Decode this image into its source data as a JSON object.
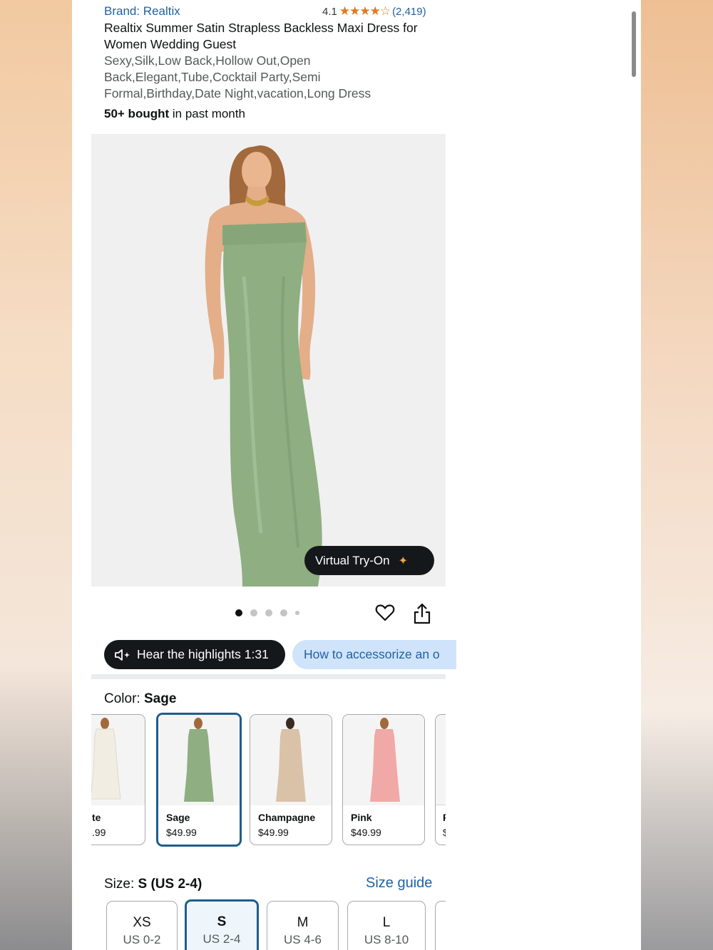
{
  "product": {
    "brand": "Brand: Realtix",
    "rating_value": "4.1",
    "rating_stars": "★★★★☆",
    "rating_count": "(2,419)",
    "title": "Realtix Summer Satin Strapless Backless Maxi Dress for Women Wedding Guest",
    "subtitle": "Sexy,Silk,Low Back,Hollow Out,Open Back,Elegant,Tube,Cocktail Party,Semi Formal,Birthday,Date Night,vacation,Long Dress",
    "bought_bold": "50+ bought",
    "bought_rest": " in past month"
  },
  "gallery": {
    "virtual_try_on": "Virtual Try-On",
    "image_count": 5,
    "active_index": 0
  },
  "actions": {
    "highlights": "Hear the highlights 1:31",
    "accessorize": "How to accessorize an o"
  },
  "color": {
    "label": "Color: ",
    "selected": "Sage",
    "options": [
      {
        "name": "te",
        "price": ".99",
        "color": "#f2ede2"
      },
      {
        "name": "Sage",
        "price": "$49.99",
        "color": "#8fae82"
      },
      {
        "name": "Champagne",
        "price": "$49.99",
        "color": "#d9c2a8"
      },
      {
        "name": "Pink",
        "price": "$49.99",
        "color": "#f0a9a7"
      },
      {
        "name": "F",
        "price": "$",
        "color": "#dddddd"
      }
    ]
  },
  "size": {
    "label": "Size: ",
    "selected": "S (US 2-4)",
    "guide": "Size guide",
    "options": [
      {
        "name": "XS",
        "us": "US 0-2"
      },
      {
        "name": "S",
        "us": "US 2-4"
      },
      {
        "name": "M",
        "us": "US 4-6"
      },
      {
        "name": "L",
        "us": "US 8-10"
      }
    ]
  },
  "colors": {
    "link": "#2162a1",
    "selected_border": "#1f5d8c",
    "star": "#de7921",
    "dress": "#8fae82"
  }
}
